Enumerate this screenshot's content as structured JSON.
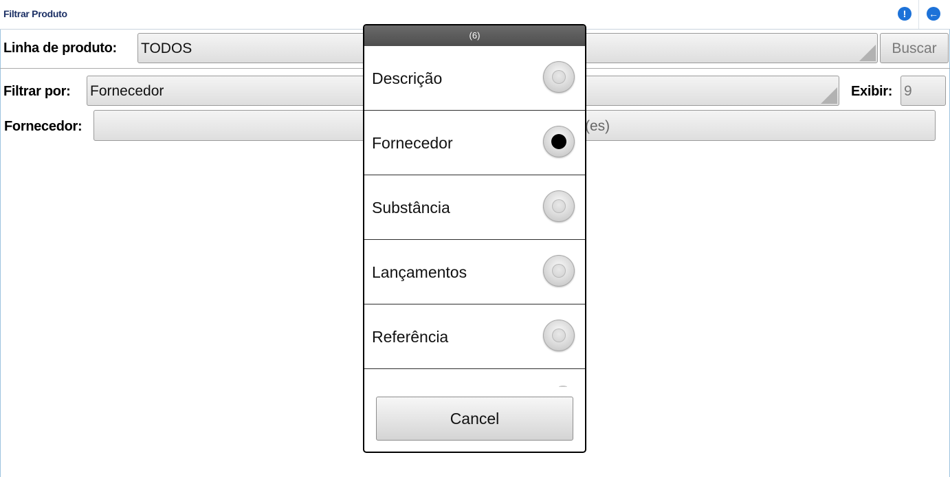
{
  "header": {
    "title": "Filtrar Produto",
    "info_icon": "info-icon",
    "back_icon": "back-arrow-icon",
    "info_glyph": "!",
    "back_glyph": "←"
  },
  "linha": {
    "label": "Linha de produto:",
    "value": "TODOS",
    "button": "Buscar"
  },
  "filtro": {
    "label": "Filtrar por:",
    "value": "Fornecedor",
    "exibir_label": "Exibir:",
    "exibir_value": "9"
  },
  "fornecedor": {
    "label": "Fornecedor:",
    "value_visible_part": "(es)"
  },
  "dialog": {
    "title": "(6)",
    "options": [
      {
        "label": "Descrição",
        "selected": false
      },
      {
        "label": "Fornecedor",
        "selected": true
      },
      {
        "label": "Substância",
        "selected": false
      },
      {
        "label": "Lançamentos",
        "selected": false
      },
      {
        "label": "Referência",
        "selected": false
      }
    ],
    "cancel": "Cancel"
  }
}
